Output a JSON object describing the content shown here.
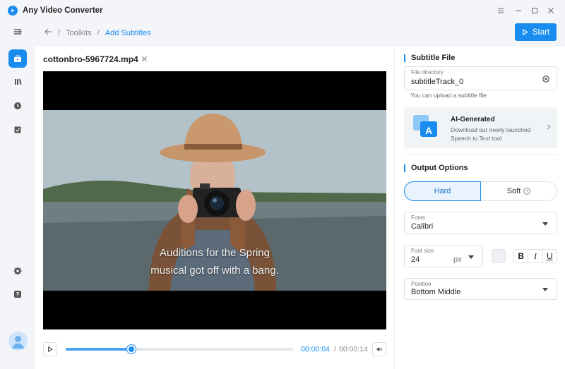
{
  "app": {
    "title": "Any Video Converter",
    "accent": "#1a8cf0"
  },
  "window_controls": [
    "menu-icon",
    "minimize-icon",
    "maximize-icon",
    "close-icon"
  ],
  "sidebar": {
    "items": [
      {
        "icon": "collapse-menu-icon"
      },
      {
        "icon": "toolbox-icon",
        "active": true
      },
      {
        "icon": "library-icon"
      },
      {
        "icon": "history-icon"
      },
      {
        "icon": "tasks-icon"
      },
      {
        "icon": "settings-icon"
      },
      {
        "icon": "help-icon"
      },
      {
        "icon": "avatar-icon"
      }
    ]
  },
  "breadcrumb": {
    "parent": "Toolkits",
    "separator": "/",
    "current": "Add Subtitles"
  },
  "toolbar": {
    "start_label": "Start"
  },
  "video": {
    "file_name": "cottonbro-5967724.mp4",
    "subtitle_line1": "Auditions for the Spring",
    "subtitle_line2": "musical got off with a bang.",
    "current_time": "00:00:04",
    "time_separator": "/",
    "total_time": "00:00:14",
    "progress": 0.29
  },
  "subtitle_file": {
    "section_title": "Subtitle File",
    "directory_label": "File directory",
    "directory_value": "subtitleTrack_0",
    "hint": "You can upload a subtitle file",
    "ai_title": "AI-Generated",
    "ai_desc": "Download our newly launched Speech to Text tool"
  },
  "output_options": {
    "section_title": "Output Options",
    "mode_hard": "Hard",
    "mode_soft": "Soft",
    "selected_mode": "Hard",
    "fonts_label": "Fonts",
    "fonts_value": "Calibri",
    "font_size_label": "Font size",
    "font_size_value": "24",
    "font_size_unit": "px",
    "bold": "B",
    "italic": "I",
    "underline": "U",
    "position_label": "Position",
    "position_value": "Bottom Middle"
  }
}
